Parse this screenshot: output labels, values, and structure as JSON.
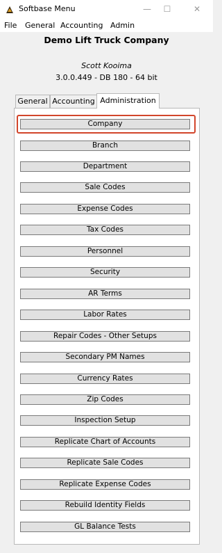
{
  "window": {
    "title": "Softbase Menu"
  },
  "menubar": [
    "File",
    "General",
    "Accounting",
    "Admin"
  ],
  "header": {
    "company": "Demo Lift Truck Company",
    "user": "Scott Kooima",
    "version": "3.0.0.449 - DB 180 - 64 bit"
  },
  "tabs": [
    "General",
    "Accounting",
    "Administration"
  ],
  "active_tab": "Administration",
  "buttons": [
    "Company",
    "Branch",
    "Department",
    "Sale Codes",
    "Expense Codes",
    "Tax Codes",
    "Personnel",
    "Security",
    "AR Terms",
    "Labor Rates",
    "Repair Codes - Other Setups",
    "Secondary PM Names",
    "Currency Rates",
    "Zip Codes",
    "Inspection Setup",
    "Replicate Chart of Accounts",
    "Replicate Sale Codes",
    "Replicate Expense Codes",
    "Rebuild Identity Fields",
    "GL Balance Tests"
  ],
  "colors": {
    "focus": "#d2452b",
    "button_face": "#e1e1e1"
  }
}
